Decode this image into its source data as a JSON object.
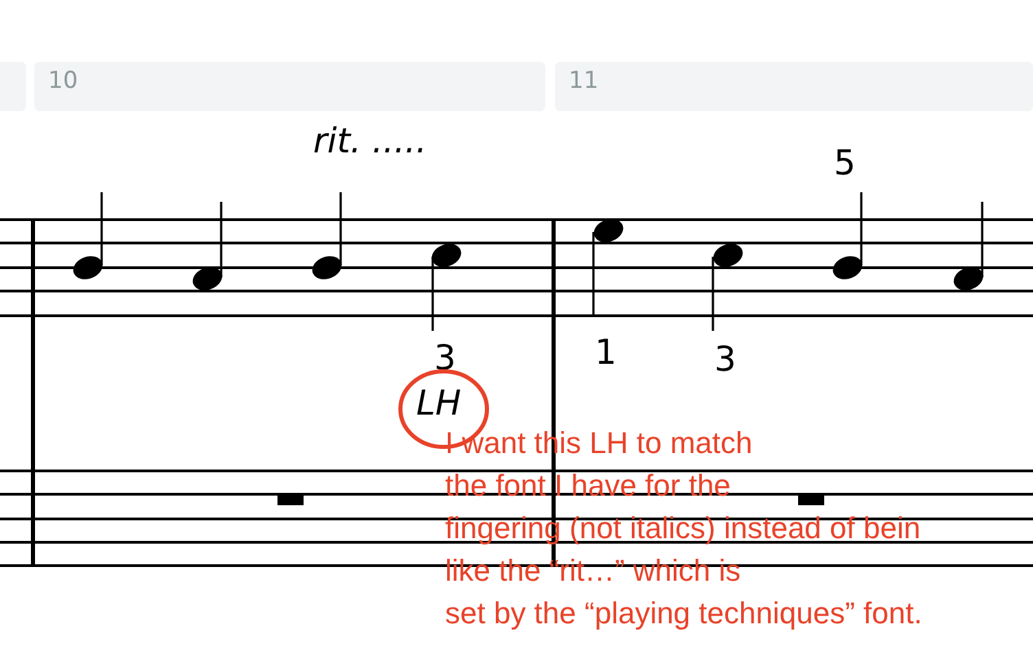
{
  "measures": [
    {
      "number": "10"
    },
    {
      "number": "11"
    }
  ],
  "tempo_text": "rit. .....",
  "fingerings": [
    "3",
    "1",
    "3",
    "5"
  ],
  "technique_text": "LH",
  "annotation": {
    "color": "#e8432a",
    "lines": [
      "I want this LH to match",
      "the font I have for the",
      "fingering (not italics) instead of bein",
      "like the “rit…” which is",
      "set by the “playing techniques” font."
    ]
  }
}
